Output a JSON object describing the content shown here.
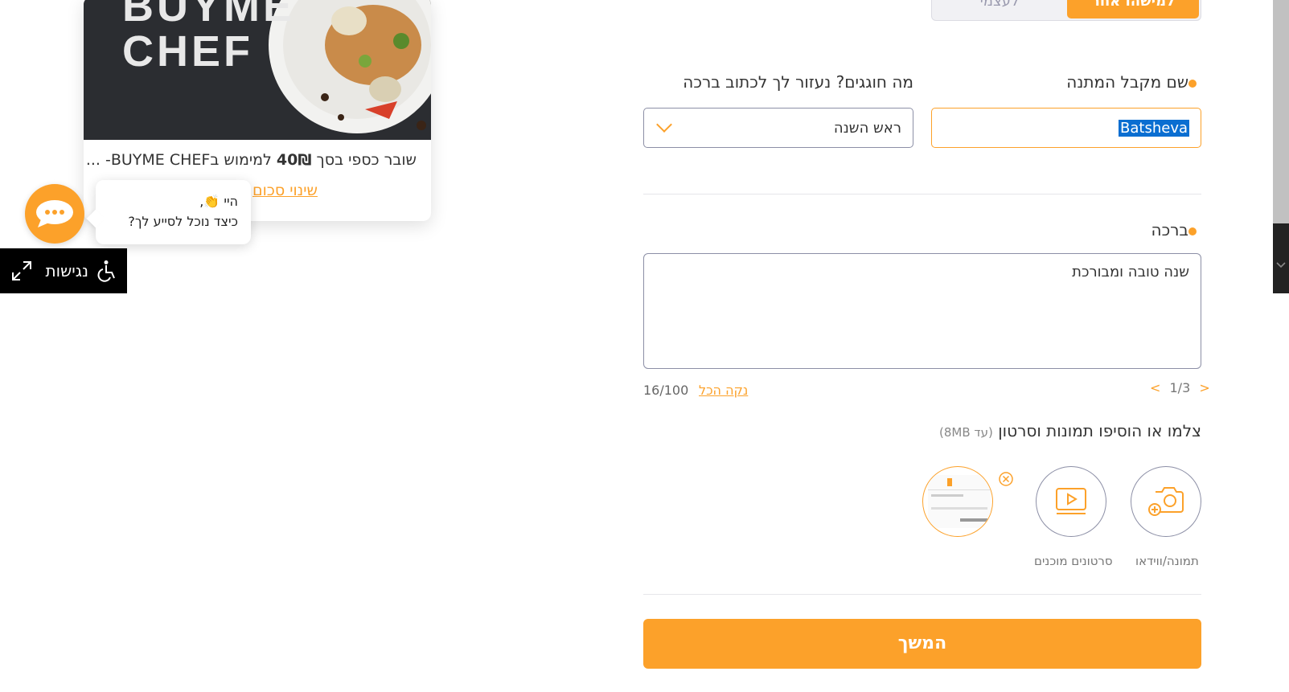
{
  "recipient_toggle": {
    "someone_else": "למישהו אחר",
    "myself": "לעצמי"
  },
  "form": {
    "recipient_label": "שם מקבל המתנה",
    "recipient_value": "Batsheva",
    "occasion_label": "מה חוגגים? נעזור לך לכתוב ברכה",
    "occasion_value": "ראש השנה",
    "greeting_label": "ברכה",
    "greeting_value": "שנה טובה ומבורכת",
    "pager": "1/3",
    "clear_all": "נקה הכל",
    "char_counter": "16/100",
    "media_title": "צלמו או הוסיפו תמונות וסרטון",
    "media_hint": "(עד 8MB)",
    "photo_video_label": "תמונה/ווידאו",
    "ready_videos_label": "סרטונים מוכנים",
    "continue_label": "המשך"
  },
  "card": {
    "brand_line1": "BUYME",
    "brand_line2": "CHEF",
    "desc_prefix": "שובר כספי בסך ",
    "amount": "40₪",
    "desc_suffix": " למימוש בBUYME CHEF- ...",
    "change_amount": "שינוי סכום"
  },
  "chat": {
    "greeting": "היי 👏,",
    "question": "כיצד נוכל לסייע לך?"
  },
  "accessibility": {
    "label": "נגישות"
  },
  "colors": {
    "accent": "#fca12a",
    "border": "#8c8fa6",
    "selection": "#0a6ed1"
  }
}
